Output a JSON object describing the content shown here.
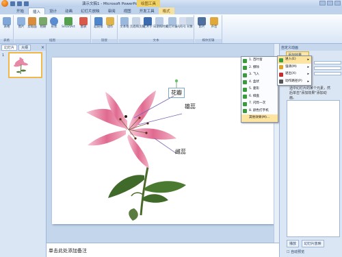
{
  "window": {
    "doc_title": "演示文稿1 - Microsoft PowerPoint",
    "ctx_title": "绘图工具"
  },
  "tabs": [
    {
      "label": "开始"
    },
    {
      "label": "插入"
    },
    {
      "label": "设计"
    },
    {
      "label": "动画"
    },
    {
      "label": "幻灯片放映"
    },
    {
      "label": "审阅"
    },
    {
      "label": "视图"
    },
    {
      "label": "开发工具"
    },
    {
      "label": "格式"
    }
  ],
  "ribbon": {
    "groups": [
      "表格",
      "插图",
      "链接",
      "文本",
      "媒体剪辑"
    ],
    "buttons": [
      "表格",
      "图片",
      "剪贴画",
      "相册",
      "形状",
      "SmartArt",
      "图表",
      "超链接",
      "动作",
      "文本框",
      "页眉和页脚",
      "艺术字",
      "日期和时间",
      "幻灯片编号",
      "符号",
      "对象",
      "影片",
      "声音"
    ]
  },
  "left_pane": {
    "tab_slides": "幻灯片",
    "tab_outline": "大纲",
    "close": "×",
    "slide_number": "1"
  },
  "slide": {
    "label_flower": "花瓣",
    "label_stamen": "雄蕊",
    "label_pistil": "雌蕊"
  },
  "notes": {
    "placeholder": "单击此处添加备注"
  },
  "task_pane": {
    "title": "自定义动画",
    "add_effect": "添加效果",
    "info": "选中幻灯片的某个元素，然后单击\"添加效果\"添加动画。",
    "play": "播放",
    "slideshow": "幻灯片放映",
    "autopreview": "自动预览"
  },
  "menus": {
    "main": [
      {
        "label": "进入(E)",
        "arrow": "▸",
        "color": "#3a9b3a"
      },
      {
        "label": "强调(M)",
        "arrow": "▸",
        "color": "#e0a020"
      },
      {
        "label": "退出(X)",
        "arrow": "▸",
        "color": "#c03030"
      },
      {
        "label": "动作路径(P)",
        "arrow": "▸",
        "color": "#555555"
      }
    ],
    "sub": [
      {
        "label": "1. 百叶窗",
        "color": "#3a9b3a"
      },
      {
        "label": "2. 擦除",
        "color": "#3a9b3a"
      },
      {
        "label": "3. 飞入",
        "color": "#3a9b3a"
      },
      {
        "label": "4. 盒状",
        "color": "#3a9b3a"
      },
      {
        "label": "5. 菱形",
        "color": "#3a9b3a"
      },
      {
        "label": "6. 棋盘",
        "color": "#3a9b3a"
      },
      {
        "label": "7. 闪烁一次",
        "color": "#3a9b3a"
      },
      {
        "label": "8. 颜色打字机",
        "color": "#3a9b3a"
      },
      {
        "label": "其他效果(M)...",
        "color": "#ffffff"
      }
    ]
  }
}
